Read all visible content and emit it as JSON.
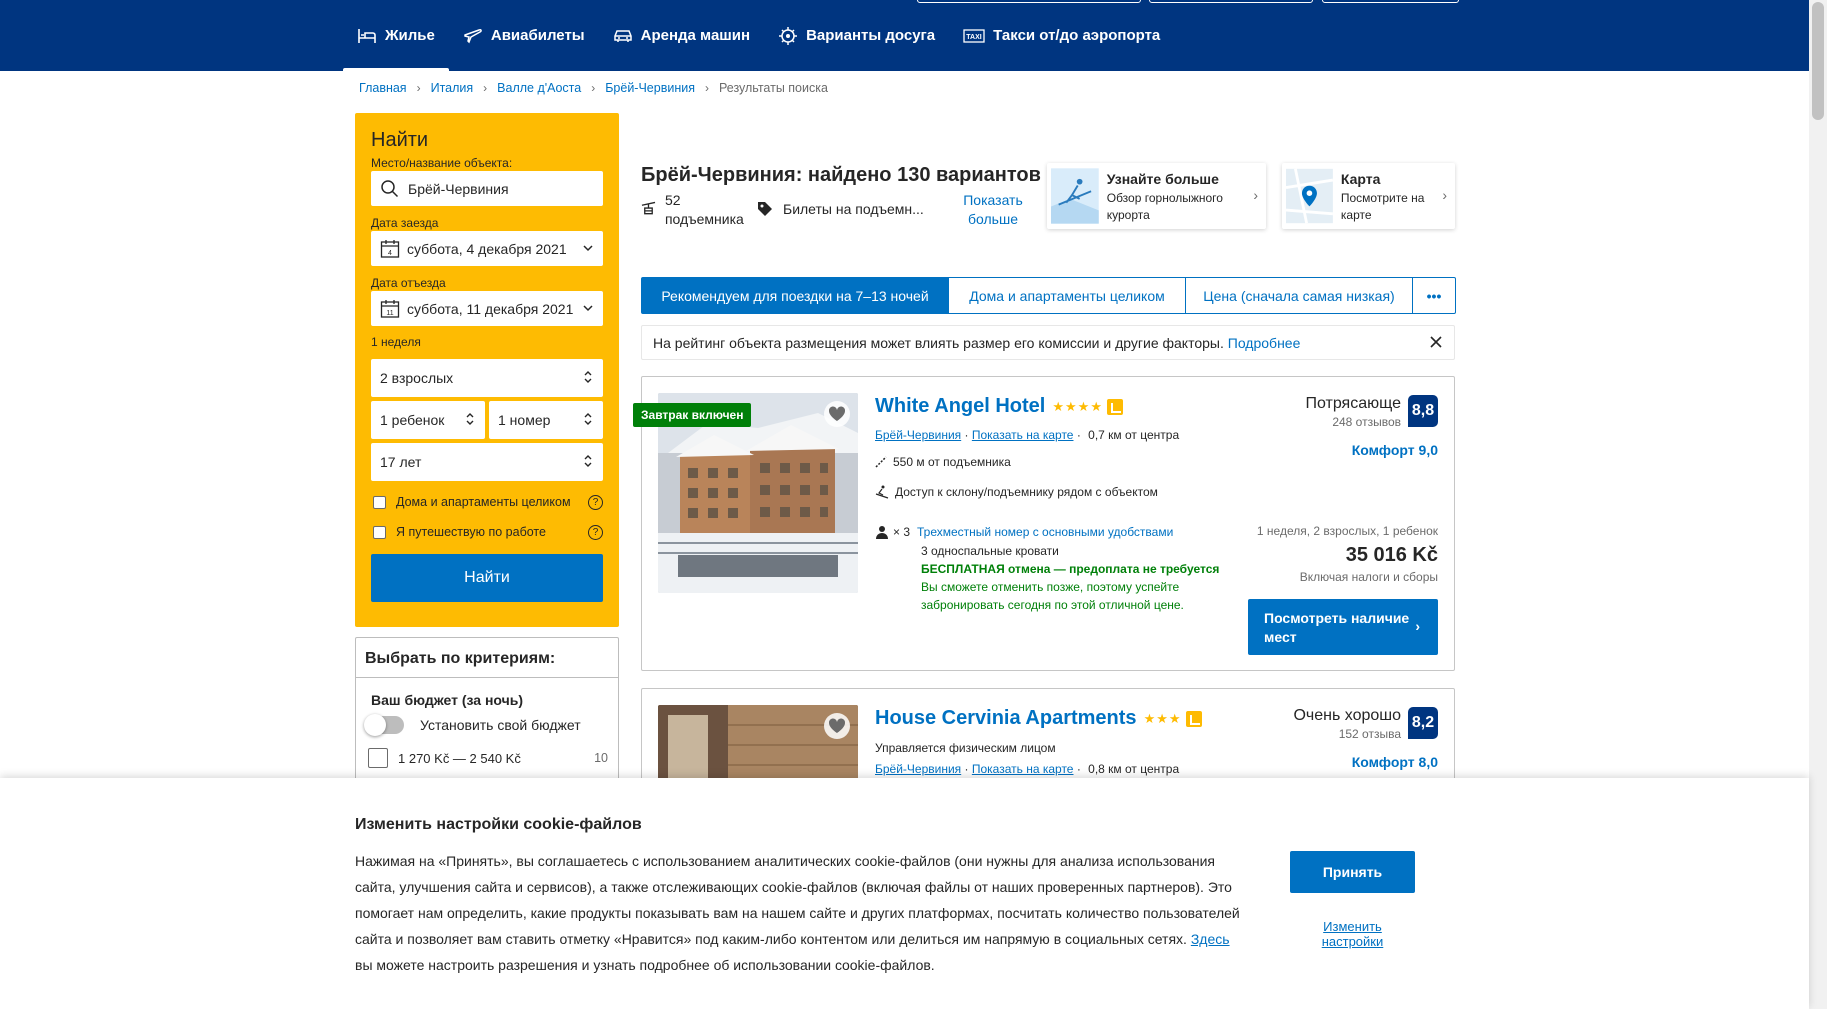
{
  "nav": {
    "items": [
      {
        "label": "Жилье",
        "icon": "bed-icon"
      },
      {
        "label": "Авиабилеты",
        "icon": "plane-icon"
      },
      {
        "label": "Аренда машин",
        "icon": "car-icon"
      },
      {
        "label": "Варианты досуга",
        "icon": "attractions-icon"
      },
      {
        "label": "Такси от/до аэропорта",
        "icon": "taxi-icon"
      }
    ]
  },
  "breadcrumb": [
    "Главная",
    "Италия",
    "Валле д'Аоста",
    "Брёй-Червиния",
    "Результаты поиска"
  ],
  "search": {
    "title": "Найти",
    "place_label": "Место/название объекта:",
    "place_value": "Брёй-Червиния",
    "checkin_label": "Дата заезда",
    "checkin_value": "суббота, 4 декабря 2021",
    "checkin_day": "4",
    "checkout_label": "Дата отъезда",
    "checkout_value": "суббота, 11 декабря 2021",
    "checkout_day": "11",
    "duration": "1 неделя",
    "adults": "2 взрослых",
    "children": "1 ребенок",
    "rooms": "1 номер",
    "child_age": "17 лет",
    "check_homes": "Дома и апартаменты целиком",
    "check_work": "Я путешествую по работе",
    "help": "?",
    "button": "Найти"
  },
  "filters": {
    "title": "Выбрать по критериям:",
    "budget_title": "Ваш бюджет (за ночь)",
    "budget_toggle": "Установить свой бюджет",
    "budget_range": "1 270 Kč — 2 540 Kč",
    "budget_count": "10"
  },
  "results": {
    "heading": "Брёй-Червиния: найдено 130 вариантов",
    "lifts": "52 подъемника",
    "tickets": "Билеты на подъемн...",
    "more": "Показать больше"
  },
  "infocards": [
    {
      "title": "Узнайте больше",
      "text": "Обзор горнолыжного курорта"
    },
    {
      "title": "Карта",
      "text": "Посмотрите на карте"
    }
  ],
  "sort_tabs": [
    "Рекомендуем для поездки на 7–13 ночей",
    "Дома и апартаменты целиком",
    "Цена (сначала самая низкая)",
    "•••"
  ],
  "notice": {
    "text": "На рейтинг объекта размещения может влиять размер его комиссии и другие факторы.",
    "link": "Подробнее"
  },
  "properties": [
    {
      "badge": "Завтрак включен",
      "name": "White Angel Hotel",
      "stars": "★★★★",
      "location": "Брёй-Червиния",
      "map_link": "Показать на карте",
      "distance": "0,7 км от центра",
      "lift_distance": "550 м от подъемника",
      "ski_access": "Доступ к склону/подъемнику рядом с объектом",
      "room_mult": "× 3",
      "room_name": "Трехместный номер с основными удобствами",
      "beds": "3 односпальные кровати",
      "free_cancel": "БЕСПЛАТНАЯ отмена — предоплата не требуется",
      "cancel_note": "Вы сможете отменить позже, поэтому успейте забронировать сегодня по этой отличной цене.",
      "score_word": "Потрясающе",
      "reviews": "248 отзывов",
      "score": "8,8",
      "comfort": "Комфорт 9,0",
      "stay": "1 неделя, 2 взрослых, 1 ребенок",
      "price": "35 016 Kč",
      "taxes": "Включая налоги и сборы",
      "button": "Посмотреть наличие мест"
    },
    {
      "name": "House Cervinia Apartments",
      "stars": "★★★",
      "managed": "Управляется физическим лицом",
      "location": "Брёй-Червиния",
      "map_link": "Показать на карте",
      "distance": "0,8 км от центра",
      "score_word": "Очень хорошо",
      "reviews": "152 отзыва",
      "score": "8,2",
      "comfort": "Комфорт 8,0"
    }
  ],
  "cookie": {
    "title": "Изменить настройки cookie-файлов",
    "text_before": "Нажимая на «Принять», вы соглашаетесь с использованием аналитических cookie-файлов (они нужны для анализа использования сайта, улучшения сайта и сервисов), а также отслеживающих cookie-файлов (включая файлы от наших проверенных партнеров). Это помогает нам определить, какие продукты показывать вам на нашем сайте и других платформах, посчитать количество пользователей сайта и позволяет вам ставить отметку «Нравится» под каким-либо контентом или делиться им напрямую в социальных сетях.",
    "link": "Здесь",
    "text_after": "вы можете настроить разрешения и узнать подробнее об использовании cookie-файлов.",
    "accept": "Принять",
    "change": "Изменить настройки"
  },
  "colors": {
    "brand": "#003580",
    "accent": "#0071c2",
    "search_bg": "#febb02",
    "green": "#008009"
  }
}
